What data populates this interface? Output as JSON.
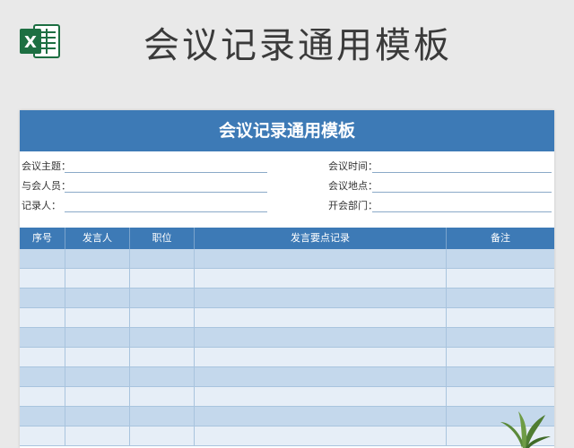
{
  "page": {
    "title": "会议记录通用模板"
  },
  "brand": {
    "logo_letter": "X",
    "logo_color": "#1d6f42"
  },
  "sheet": {
    "header_title": "会议记录通用模板",
    "header_color": "#3d7ab6",
    "info": {
      "topic_label": "会议主题：",
      "time_label": "会议时间：",
      "attendees_label": "与会人员：",
      "location_label": "会议地点：",
      "recorder_label": "记录人：",
      "department_label": "开会部门："
    },
    "columns": {
      "index": "序号",
      "speaker": "发言人",
      "position": "职位",
      "notes": "发言要点记录",
      "remarks": "备注"
    },
    "row_fill_odd": "#c4d8ec",
    "row_fill_even": "#e6eef7"
  }
}
